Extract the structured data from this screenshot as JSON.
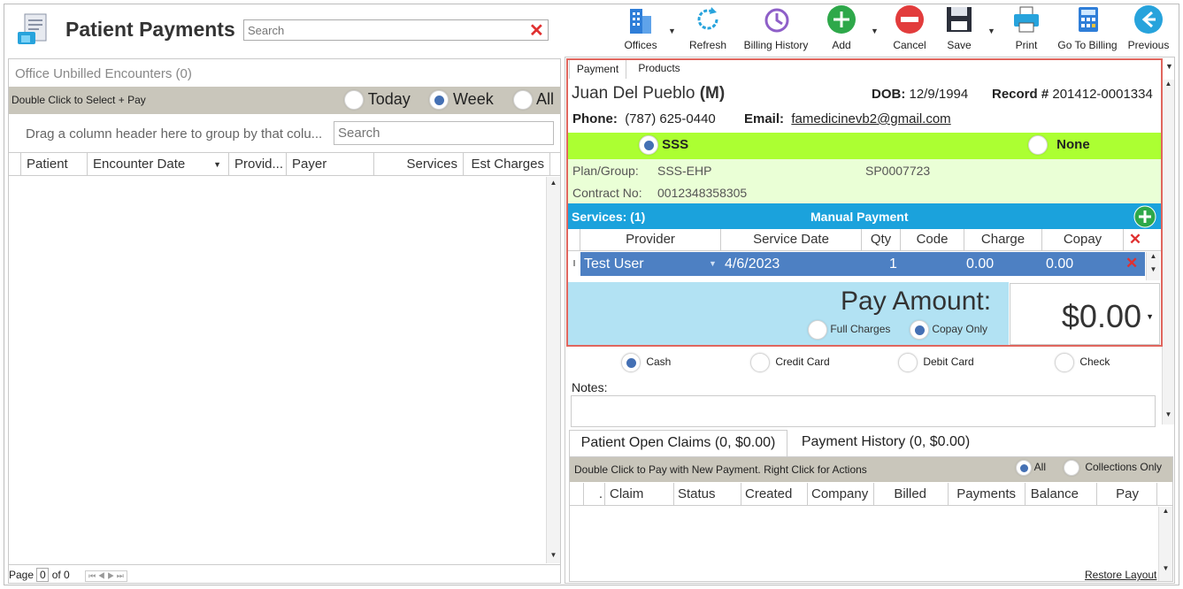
{
  "header": {
    "title": "Patient Payments",
    "search_placeholder": "Search"
  },
  "toolbar": [
    {
      "label": "Offices",
      "icon": "offices-icon"
    },
    {
      "label": "Refresh",
      "icon": "refresh-icon"
    },
    {
      "label": "Billing History",
      "icon": "billing-history-icon"
    },
    {
      "label": "Add",
      "icon": "add-icon"
    },
    {
      "label": "Cancel",
      "icon": "cancel-icon"
    },
    {
      "label": "Save",
      "icon": "save-icon"
    },
    {
      "label": "Print",
      "icon": "print-icon"
    },
    {
      "label": "Go To Billing",
      "icon": "go-to-billing-icon"
    },
    {
      "label": "Previous",
      "icon": "previous-icon"
    }
  ],
  "left": {
    "title": "Office Unbilled Encounters (0)",
    "hint": "Double Click to Select + Pay",
    "filters": {
      "today": "Today",
      "week": "Week",
      "all": "All",
      "selected": "Week"
    },
    "group_hint": "Drag a column header here to group by that colu...",
    "search_placeholder": "Search",
    "columns": [
      "Patient",
      "Encounter Date",
      "Provid...",
      "Payer",
      "Services",
      "Est Charges"
    ],
    "pager": {
      "page_label": "Page",
      "page": "0",
      "of_label": "of 0",
      "nav": "⏮ ◀ ▶ ⏭"
    }
  },
  "tabs": {
    "payment": "Payment",
    "products": "Products"
  },
  "patient": {
    "name": "Juan Del Pueblo",
    "sex": "(M)",
    "dob_label": "DOB:",
    "dob": "12/9/1994",
    "record_label": "Record #",
    "record": "201412-0001334",
    "phone_label": "Phone:",
    "phone": "(787) 625-0440",
    "email_label": "Email:",
    "email": "famedicinevb2@gmail.com"
  },
  "insurance": {
    "primary": "SSS",
    "none": "None",
    "plan_label": "Plan/Group:",
    "plan": "SSS-EHP",
    "group": "SP0007723",
    "contract_label": "Contract No:",
    "contract": "0012348358305"
  },
  "services": {
    "title": "Services: (1)",
    "mode": "Manual Payment",
    "columns": [
      "Provider",
      "Service Date",
      "Qty",
      "Code",
      "Charge",
      "Copay"
    ],
    "rows": [
      {
        "provider": "Test User",
        "date": "4/6/2023",
        "qty": "1",
        "code": "",
        "charge": "0.00",
        "copay": "0.00"
      }
    ]
  },
  "pay": {
    "label": "Pay Amount:",
    "amount": "$0.00",
    "full": "Full Charges",
    "copay_only": "Copay Only"
  },
  "methods": {
    "cash": "Cash",
    "credit": "Credit Card",
    "debit": "Debit Card",
    "check": "Check"
  },
  "notes_label": "Notes:",
  "claims": {
    "tab_open": "Patient Open Claims (0, $0.00)",
    "tab_history": "Payment History (0, $0.00)",
    "hint": "Double Click to Pay with New Payment. Right Click for Actions",
    "all": "All",
    "collections": "Collections Only",
    "columns": [
      "Claim",
      "Status",
      "Created",
      "Company",
      "Billed",
      "Payments",
      "Balance",
      "Pay"
    ],
    "restore": "Restore Layout"
  },
  "colors": {
    "accent": "#1ba2dc",
    "green": "#acff32",
    "selected": "#4d80c3",
    "highlight_border": "#e0665e"
  }
}
